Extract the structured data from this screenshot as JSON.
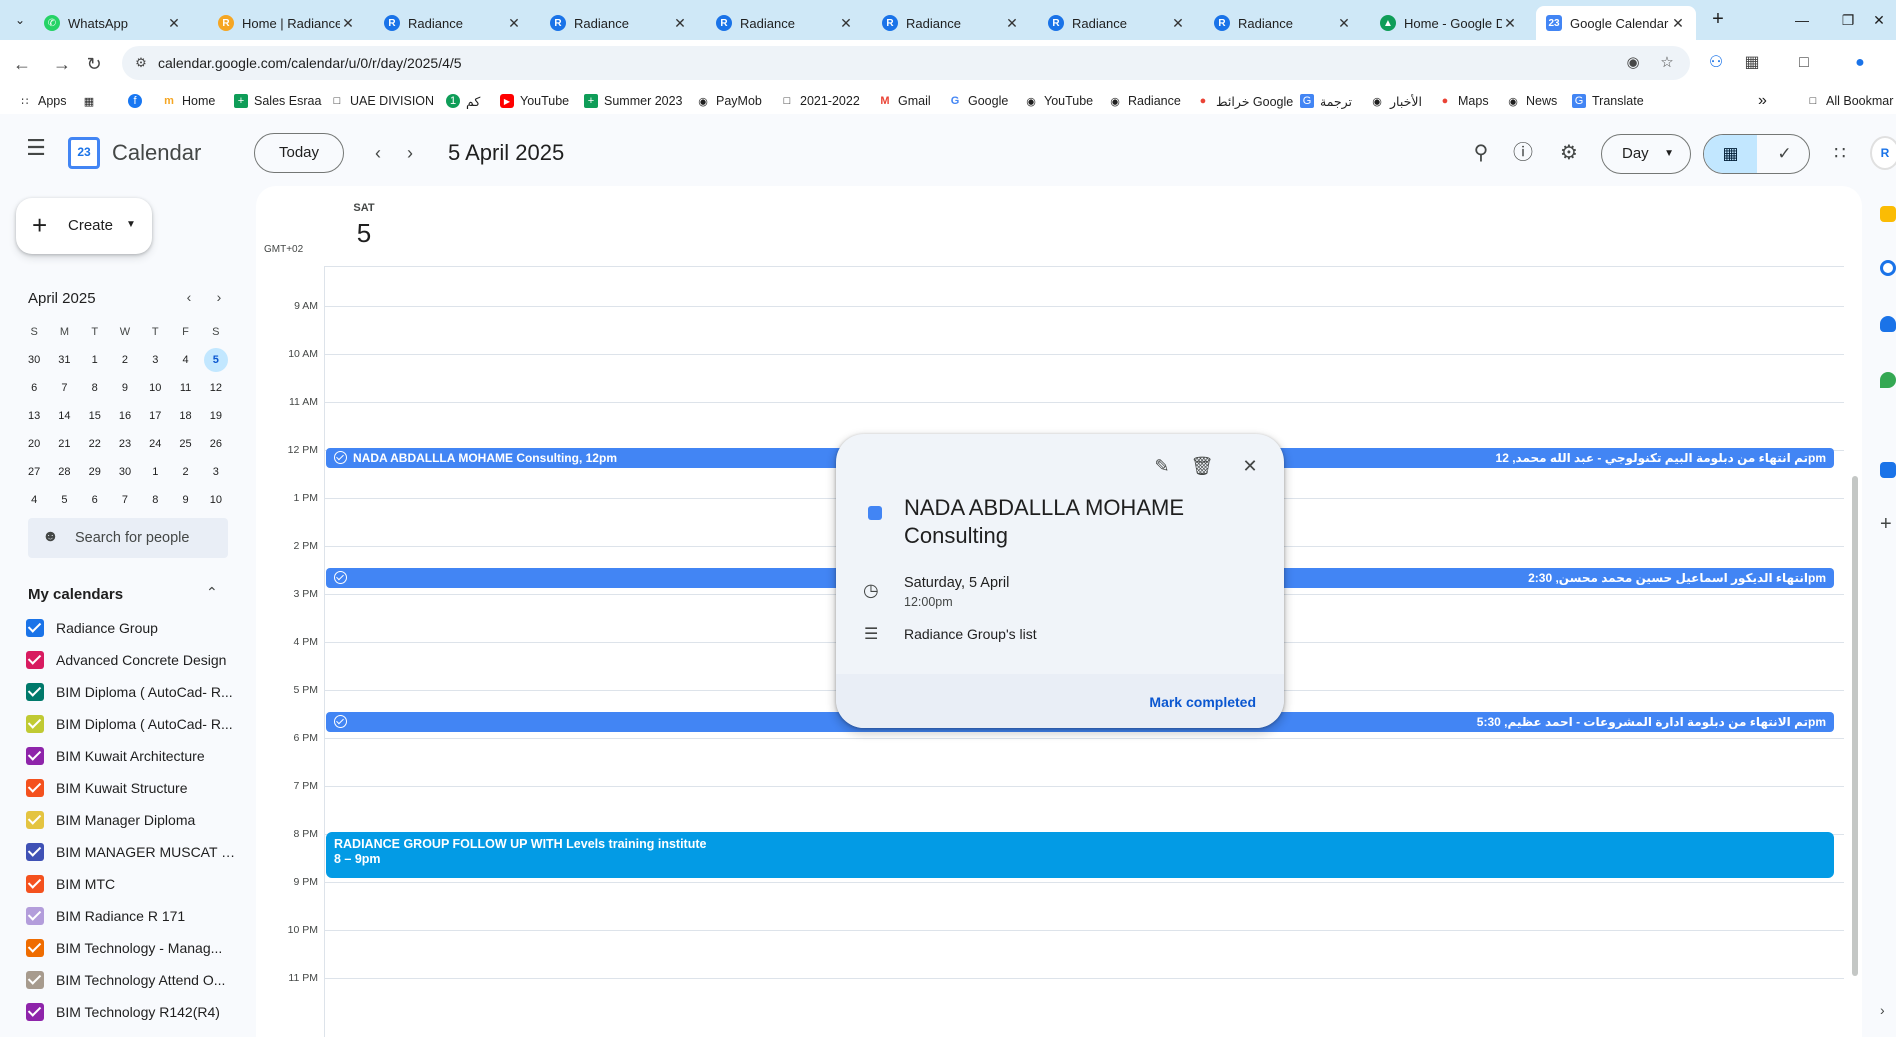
{
  "browser": {
    "tabs": [
      {
        "title": "WhatsApp",
        "icon": "whatsapp-icon",
        "color": "#25d366"
      },
      {
        "title": "Home | Radiance",
        "icon": "radiance-icon",
        "color": "#f5a623"
      },
      {
        "title": "Radiance",
        "icon": "radiance-icon",
        "color": "#1a73e8"
      },
      {
        "title": "Radiance",
        "icon": "radiance-icon",
        "color": "#1a73e8"
      },
      {
        "title": "Radiance",
        "icon": "radiance-icon",
        "color": "#1a73e8"
      },
      {
        "title": "Radiance",
        "icon": "radiance-icon",
        "color": "#1a73e8"
      },
      {
        "title": "Radiance",
        "icon": "radiance-icon",
        "color": "#1a73e8"
      },
      {
        "title": "Radiance",
        "icon": "radiance-icon",
        "color": "#1a73e8"
      },
      {
        "title": "Home - Google D",
        "icon": "google-drive-icon",
        "color": "#0f9d58"
      },
      {
        "title": "Google Calendar",
        "icon": "google-calendar-icon",
        "color": "#4285f4"
      }
    ],
    "url": "calendar.google.com/calendar/u/0/r/day/2025/4/5",
    "bookmarks": [
      {
        "label": "Apps",
        "icon": "apps-grid-icon"
      },
      {
        "label": "",
        "icon": "grid-icon"
      },
      {
        "label": "",
        "icon": "facebook-icon"
      },
      {
        "label": "Home",
        "icon": "home-bookmark-icon"
      },
      {
        "label": "Sales Esraa",
        "icon": "sheets-icon"
      },
      {
        "label": "UAE DIVISION",
        "icon": "folder-icon"
      },
      {
        "label": "كم",
        "icon": "circle-icon"
      },
      {
        "label": "YouTube",
        "icon": "youtube-icon"
      },
      {
        "label": "Summer 2023",
        "icon": "sheets-icon"
      },
      {
        "label": "PayMob",
        "icon": "globe-icon"
      },
      {
        "label": "2021-2022",
        "icon": "folder-icon"
      },
      {
        "label": "Gmail",
        "icon": "gmail-icon"
      },
      {
        "label": "Google",
        "icon": "google-icon"
      },
      {
        "label": "YouTube",
        "icon": "globe-icon"
      },
      {
        "label": "Radiance",
        "icon": "globe-icon"
      },
      {
        "label": "خرائط Google",
        "icon": "maps-icon"
      },
      {
        "label": "ترجمة",
        "icon": "translate-icon"
      },
      {
        "label": "الأخبار",
        "icon": "globe-icon"
      },
      {
        "label": "Maps",
        "icon": "maps-icon"
      },
      {
        "label": "News",
        "icon": "globe-icon"
      },
      {
        "label": "Translate",
        "icon": "translate-icon"
      }
    ],
    "all_bookmarks": "All Bookmar"
  },
  "app": {
    "name": "Calendar",
    "logo_day": "23",
    "today_label": "Today",
    "date_title": "5 April 2025",
    "view": "Day"
  },
  "create": {
    "label": "Create"
  },
  "mini_calendar": {
    "title": "April 2025",
    "weekdays": [
      "S",
      "M",
      "T",
      "W",
      "T",
      "F",
      "S"
    ],
    "weeks": [
      [
        "30",
        "31",
        "1",
        "2",
        "3",
        "4",
        "5"
      ],
      [
        "6",
        "7",
        "8",
        "9",
        "10",
        "11",
        "12"
      ],
      [
        "13",
        "14",
        "15",
        "16",
        "17",
        "18",
        "19"
      ],
      [
        "20",
        "21",
        "22",
        "23",
        "24",
        "25",
        "26"
      ],
      [
        "27",
        "28",
        "29",
        "30",
        "1",
        "2",
        "3"
      ],
      [
        "4",
        "5",
        "6",
        "7",
        "8",
        "9",
        "10"
      ]
    ],
    "selected": "5"
  },
  "search_people": {
    "placeholder": "Search for people"
  },
  "my_calendars": {
    "title": "My calendars",
    "items": [
      {
        "name": "Radiance Group",
        "color": "#1a73e8"
      },
      {
        "name": "Advanced Concrete Design",
        "color": "#d81b60"
      },
      {
        "name": "BIM Diploma ( AutoCad- R...",
        "color": "#00796b"
      },
      {
        "name": "BIM Diploma ( AutoCad- R...",
        "color": "#c0ca33"
      },
      {
        "name": "BIM Kuwait Architecture",
        "color": "#8e24aa"
      },
      {
        "name": "BIM Kuwait Structure",
        "color": "#f4511e"
      },
      {
        "name": "BIM Manager Diploma",
        "color": "#e4c441"
      },
      {
        "name": "BIM MANAGER MUSCAT B...",
        "color": "#3f51b5"
      },
      {
        "name": "BIM MTC",
        "color": "#f4511e"
      },
      {
        "name": "BIM Radiance R 171",
        "color": "#b39ddb"
      },
      {
        "name": "BIM Technology - Manag...",
        "color": "#ef6c00"
      },
      {
        "name": "BIM Technology Attend O...",
        "color": "#a79b8e"
      },
      {
        "name": "BIM Technology R142(R4)",
        "color": "#8e24aa"
      }
    ]
  },
  "day_view": {
    "dow": "SAT",
    "day": "5",
    "timezone": "GMT+02",
    "hours": [
      "9 AM",
      "10 AM",
      "11 AM",
      "12 PM",
      "1 PM",
      "2 PM",
      "3 PM",
      "4 PM",
      "5 PM",
      "6 PM",
      "7 PM",
      "8 PM",
      "9 PM",
      "10 PM",
      "11 PM"
    ],
    "events": [
      {
        "title": "NADA ABDALLLA MOHAME Consulting, 12pm",
        "right": "تم انتهاء من دبلومة البيم تكنولوجي - عبد الله محمد, 12pm"
      },
      {
        "title": "",
        "right": "انتهاء الديكور اسماعيل حسين محمد محسن, 2:30pm"
      },
      {
        "title": "",
        "right": "تم الانتهاء من دبلومة ادارة المشروعات - احمد عظيم, 5:30pm"
      }
    ],
    "big_event": {
      "title": "RADIANCE GROUP FOLLOW UP WITH Levels training institute",
      "time": "8 – 9pm"
    }
  },
  "popup": {
    "title": "NADA ABDALLLA MOHAME Consulting",
    "date": "Saturday, 5 April",
    "time": "12:00pm",
    "list": "Radiance Group's list",
    "mark_completed": "Mark completed",
    "color": "#4285f4"
  }
}
